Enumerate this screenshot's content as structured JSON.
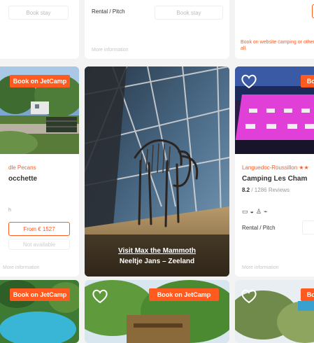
{
  "cards_row1": {
    "left": {
      "button": "Book stay"
    },
    "middle": {
      "type": "Rental / Pitch",
      "button": "Book stay",
      "info": "More information"
    },
    "right": {
      "book_link": "Book on website camping or other all."
    }
  },
  "cards_row2": {
    "left": {
      "badge": "Book on JetCamp",
      "region": "dle Pecans",
      "name": "occhette",
      "price_button": "From € 1527",
      "availability_button": "Not available",
      "info": "More information"
    },
    "ad": {
      "line1": "Visit Max the Mammoth",
      "line2": "Neeltje Jans – Zeeland"
    },
    "right": {
      "badge": "Book",
      "region": "Languedoc-Roussillon ★★",
      "name": "Camping Les Cham",
      "rating": "8.2",
      "reviews": "/ 1286 Reviews",
      "type": "Rental / Pitch",
      "info": "More information"
    }
  },
  "cards_row3": {
    "left": {
      "badge": "Book on JetCamp"
    },
    "middle": {
      "badge": "Book on JetCamp"
    },
    "right": {
      "badge": "Book"
    }
  },
  "colors": {
    "accent": "#ff5a1f",
    "text": "#333333",
    "muted": "#c7c7c7"
  }
}
